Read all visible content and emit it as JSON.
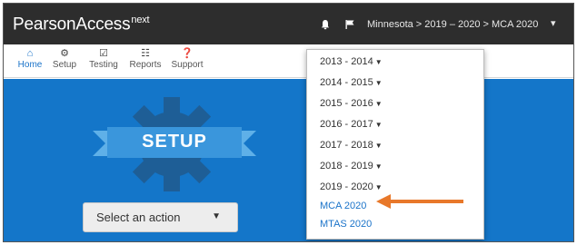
{
  "header": {
    "brand": "PearsonAccess",
    "brand_sup": "next",
    "context": "Minnesota > 2019 – 2020 > MCA 2020",
    "icons": [
      "bell-icon",
      "flag-icon",
      "chevron-down-icon"
    ]
  },
  "nav": {
    "items": [
      {
        "label": "Home",
        "icon": "home-icon"
      },
      {
        "label": "Setup",
        "icon": "gear-icon"
      },
      {
        "label": "Testing",
        "icon": "checklist-icon"
      },
      {
        "label": "Reports",
        "icon": "reports-icon"
      },
      {
        "label": "Support",
        "icon": "help-icon"
      }
    ]
  },
  "hero": {
    "title": "SETUP",
    "select_label": "Select an action"
  },
  "dropdown": {
    "years": [
      "2013 - 2014",
      "2014 - 2015",
      "2015 - 2016",
      "2016 - 2017",
      "2017 - 2018",
      "2018 - 2019",
      "2019 - 2020"
    ],
    "tests": [
      "MCA 2020",
      "MTAS 2020"
    ]
  },
  "colors": {
    "topbar": "#2d2d2d",
    "hero": "#1476c9",
    "link": "#1a73c9",
    "arrow": "#e8782a"
  }
}
